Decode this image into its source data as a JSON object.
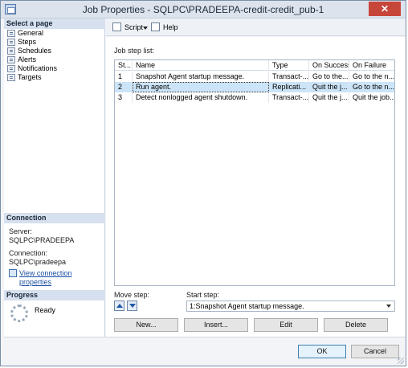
{
  "window": {
    "title": "Job Properties - SQLPC\\PRADEEPA-credit-credit_pub-1",
    "close_glyph": "✕"
  },
  "left_pane": {
    "select_page_header": "Select a page",
    "pages": [
      "General",
      "Steps",
      "Schedules",
      "Alerts",
      "Notifications",
      "Targets"
    ],
    "connection_header": "Connection",
    "server_label": "Server:",
    "server_value": "SQLPC\\PRADEEPA",
    "connection_label": "Connection:",
    "connection_value": "SQLPC\\pradeepa",
    "view_link": "View connection properties",
    "progress_header": "Progress",
    "progress_status": "Ready"
  },
  "toolbar": {
    "script_label": "Script",
    "help_label": "Help"
  },
  "main": {
    "job_step_list_label": "Job step list:",
    "columns": [
      "St...",
      "Name",
      "Type",
      "On Success",
      "On Failure"
    ],
    "rows": [
      {
        "step": "1",
        "name": "Snapshot Agent startup message.",
        "type": "Transact-...",
        "on_success": "Go to the...",
        "on_failure": "Go to the n..."
      },
      {
        "step": "2",
        "name": "Run agent.",
        "type": "Replicati...",
        "on_success": "Quit the j...",
        "on_failure": "Go to the n..."
      },
      {
        "step": "3",
        "name": "Detect nonlogged agent shutdown.",
        "type": "Transact-...",
        "on_success": "Quit the j...",
        "on_failure": "Quit the job..."
      }
    ],
    "selected_row": 1,
    "move_step_label": "Move step:",
    "start_step_label": "Start step:",
    "start_step_value": "1:Snapshot Agent startup message.",
    "buttons": {
      "new": "New...",
      "insert": "Insert...",
      "edit": "Edit",
      "delete": "Delete"
    }
  },
  "footer": {
    "ok": "OK",
    "cancel": "Cancel"
  },
  "colors": {
    "selection": "#cce4f7",
    "link": "#1a4fa3",
    "header_bg": "#d6e0ee"
  }
}
